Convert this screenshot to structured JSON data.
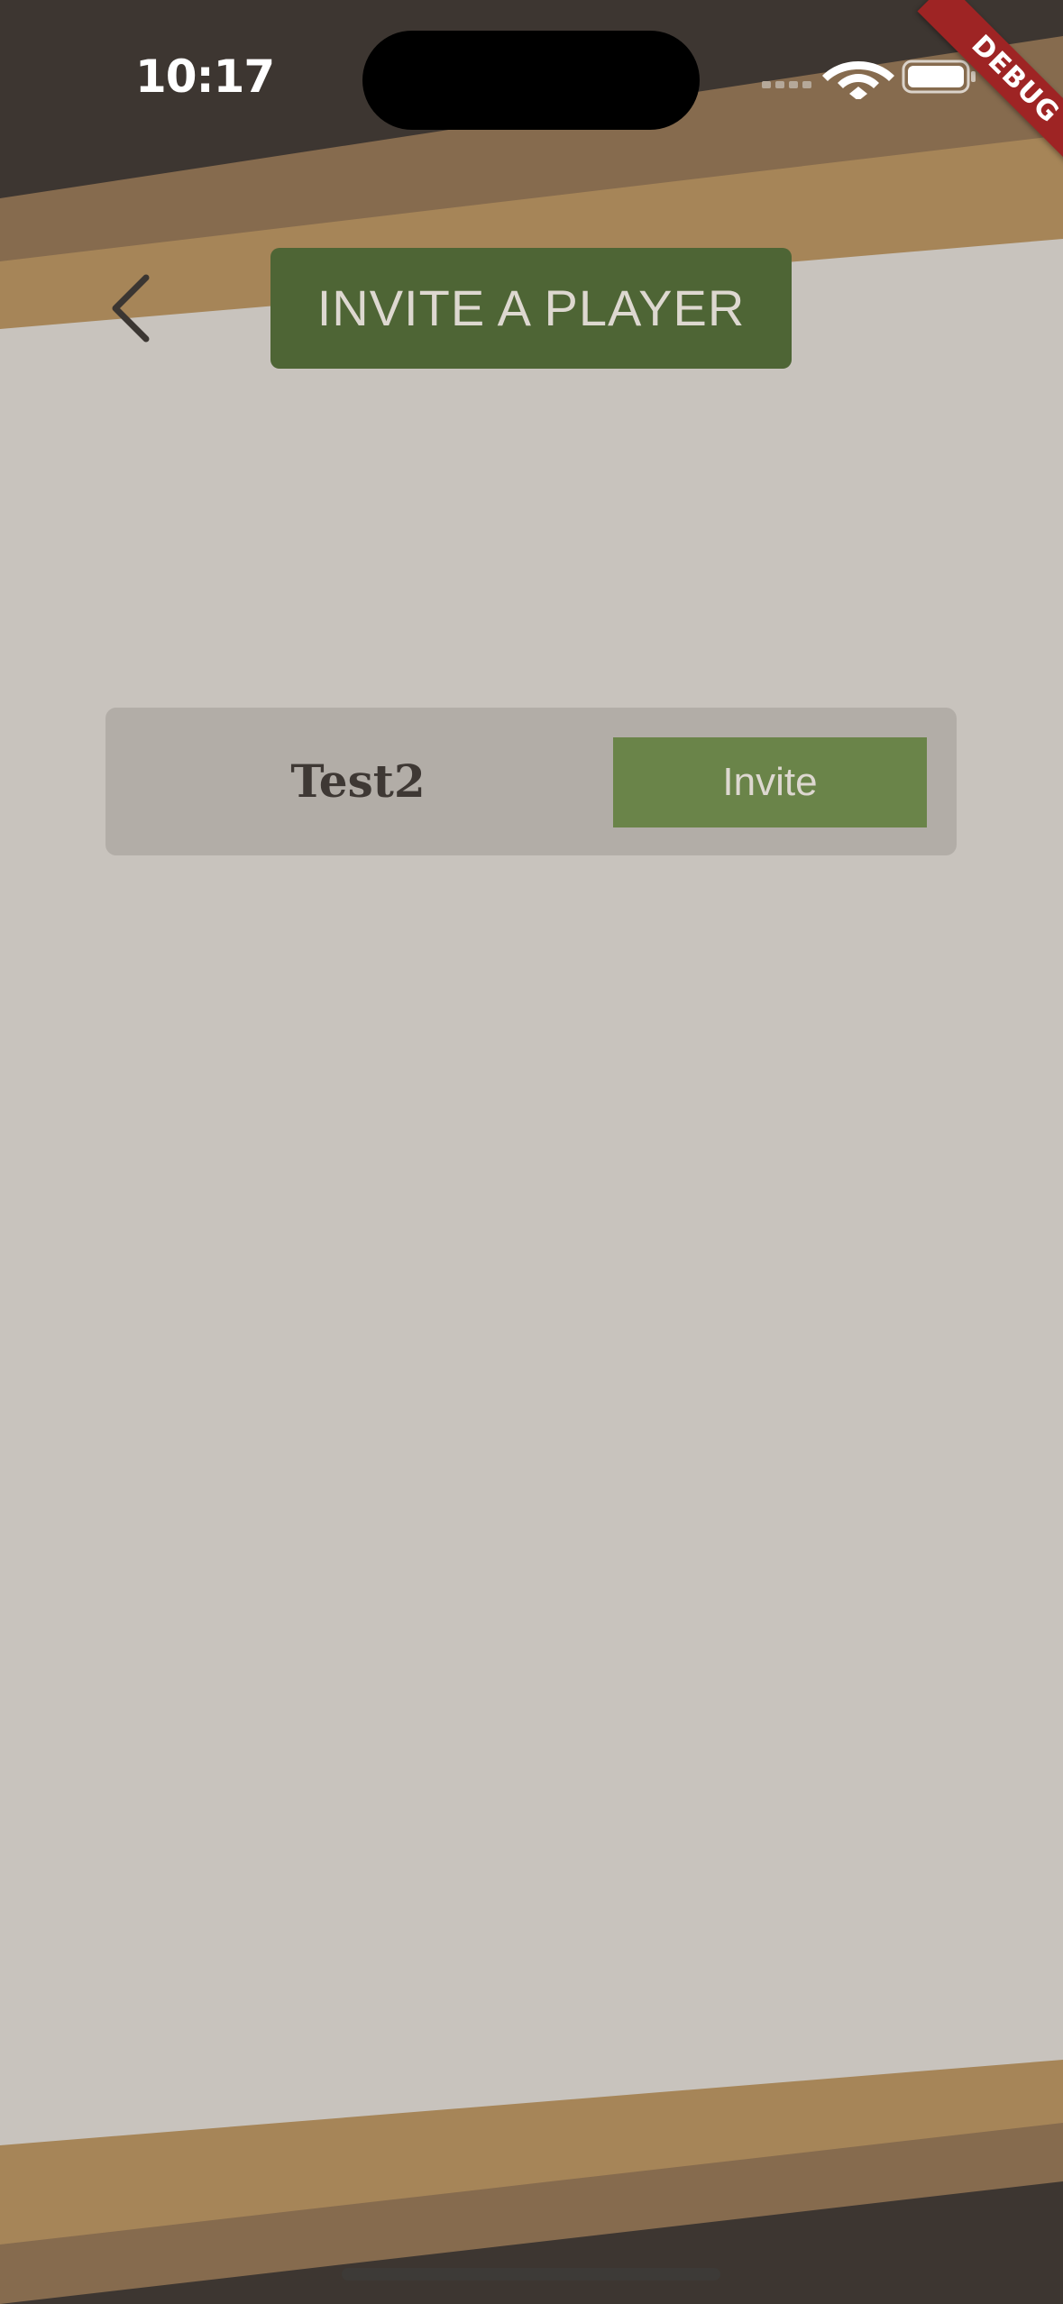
{
  "status_bar": {
    "time": "10:17",
    "icons": [
      "cellular-signal-icon",
      "wifi-icon",
      "battery-icon"
    ]
  },
  "debug_banner": {
    "label": "DEBUG",
    "color": "#9e2424"
  },
  "header": {
    "back_icon": "chevron-left-icon",
    "title": "INVITE A PLAYER"
  },
  "players": [
    {
      "name": "Test2",
      "action_label": "Invite"
    }
  ],
  "colors": {
    "background": "#c8c3bd",
    "wood_light": "#a68558",
    "wood_mid": "#866b4e",
    "wood_dark": "#3d3631",
    "primary_green": "#4e6535",
    "button_green": "#6a8449",
    "card": "#b2ada7",
    "text_dark": "#3e3834",
    "text_light": "#ddd8d0"
  }
}
